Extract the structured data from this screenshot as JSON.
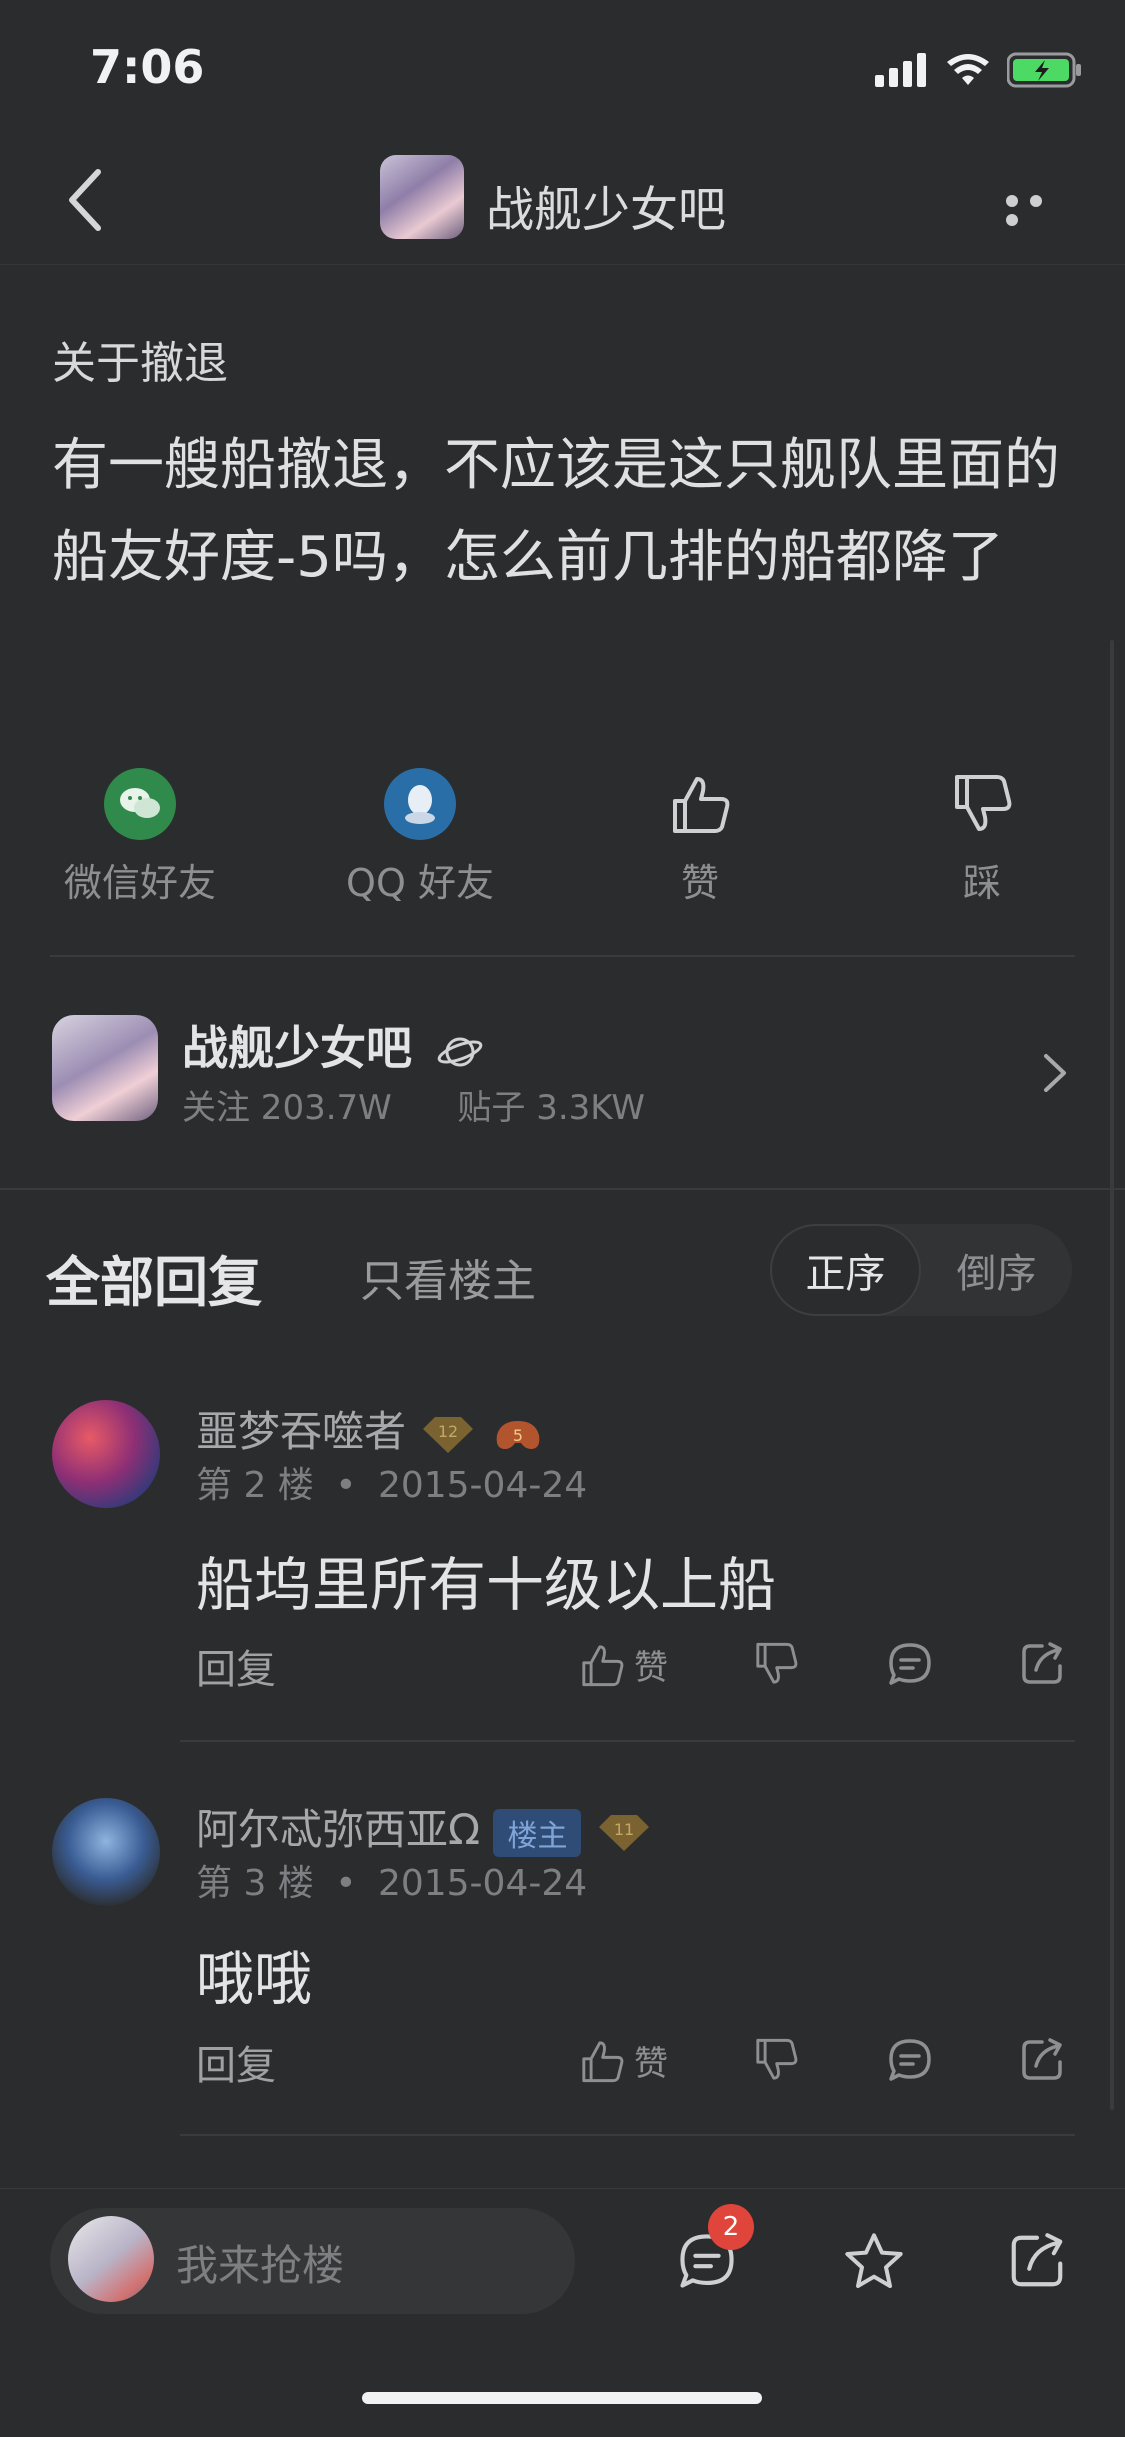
{
  "status_bar": {
    "time": "7:06"
  },
  "nav": {
    "title": "战舰少女吧"
  },
  "post": {
    "title": "关于撤退",
    "body": "有一艘船撤退，不应该是这只舰队里面的船友好度-5吗，怎么前几排的船都降了"
  },
  "share": [
    {
      "label": "微信好友",
      "icon": "wechat-icon",
      "color": "#2f8a4c"
    },
    {
      "label": "QQ 好友",
      "icon": "qq-icon",
      "color": "#2a6ea8"
    },
    {
      "label": "赞",
      "icon": "thumbs-up-icon"
    },
    {
      "label": "踩",
      "icon": "thumbs-down-icon"
    }
  ],
  "forum": {
    "name": "战舰少女吧",
    "followers_label": "关注 203.7W",
    "posts_label": "贴子 3.3KW"
  },
  "tabs": {
    "all": "全部回复",
    "op_only": "只看楼主",
    "sort_asc": "正序",
    "sort_desc": "倒序"
  },
  "replies": [
    {
      "username": "噩梦吞噬者",
      "level1": "12",
      "level2": "5",
      "floor": "第 2 楼",
      "date": "2015-04-24",
      "content": "船坞里所有十级以上船",
      "reply_label": "回复",
      "like_label": "赞"
    },
    {
      "username": "阿尔忒弥西亚Ω",
      "owner_badge": "楼主",
      "level1": "11",
      "floor": "第 3 楼",
      "date": "2015-04-24",
      "content": "哦哦",
      "reply_label": "回复",
      "like_label": "赞"
    }
  ],
  "bottom": {
    "input_placeholder": "我来抢楼",
    "comment_count": "2"
  },
  "colors": {
    "background": "#2b2c2e",
    "owner_badge": "#2f4c76",
    "notification": "#e0453b"
  }
}
